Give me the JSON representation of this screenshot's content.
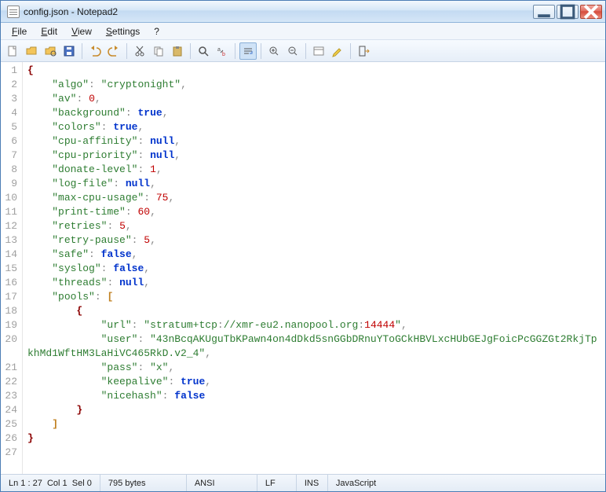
{
  "window": {
    "title": "config.json - Notepad2"
  },
  "menu": {
    "file": "File",
    "edit": "Edit",
    "view": "View",
    "settings": "Settings",
    "help": "?"
  },
  "toolbar_icons": [
    "new",
    "open",
    "browse",
    "save",
    "undo",
    "redo",
    "cut",
    "copy",
    "paste",
    "find",
    "replace",
    "wordwrap",
    "zoomin",
    "zoomout",
    "scheme",
    "highlight",
    "exit"
  ],
  "code": {
    "lines": [
      {
        "n": 1,
        "raw": "{"
      },
      {
        "n": 2,
        "raw": "    \"algo\": \"cryptonight\","
      },
      {
        "n": 3,
        "raw": "    \"av\": 0,"
      },
      {
        "n": 4,
        "raw": "    \"background\": true,"
      },
      {
        "n": 5,
        "raw": "    \"colors\": true,"
      },
      {
        "n": 6,
        "raw": "    \"cpu-affinity\": null,"
      },
      {
        "n": 7,
        "raw": "    \"cpu-priority\": null,"
      },
      {
        "n": 8,
        "raw": "    \"donate-level\": 1,"
      },
      {
        "n": 9,
        "raw": "    \"log-file\": null,"
      },
      {
        "n": 10,
        "raw": "    \"max-cpu-usage\": 75,"
      },
      {
        "n": 11,
        "raw": "    \"print-time\": 60,"
      },
      {
        "n": 12,
        "raw": "    \"retries\": 5,"
      },
      {
        "n": 13,
        "raw": "    \"retry-pause\": 5,"
      },
      {
        "n": 14,
        "raw": "    \"safe\": false,"
      },
      {
        "n": 15,
        "raw": "    \"syslog\": false,"
      },
      {
        "n": 16,
        "raw": "    \"threads\": null,"
      },
      {
        "n": 17,
        "raw": "    \"pools\": ["
      },
      {
        "n": 18,
        "raw": "        {"
      },
      {
        "n": 19,
        "raw": "            \"url\": \"stratum+tcp://xmr-eu2.nanopool.org:14444\","
      },
      {
        "n": 20,
        "raw": "            \"user\": \"43nBcqAKUguTbKPawn4on4dDkd5snGGbDRnuYToGCkHBVLxcHUbGEJgFoicPcGGZGt2RkjTpkhMd1WftHM3LaHiVC465RkD.v2_4\","
      },
      {
        "n": 21,
        "raw": "            \"pass\": \"x\","
      },
      {
        "n": 22,
        "raw": "            \"keepalive\": true,"
      },
      {
        "n": 23,
        "raw": "            \"nicehash\": false"
      },
      {
        "n": 24,
        "raw": "        }"
      },
      {
        "n": 25,
        "raw": "    ]"
      },
      {
        "n": 26,
        "raw": "}"
      },
      {
        "n": 27,
        "raw": ""
      }
    ]
  },
  "status": {
    "pos": "Ln 1 : 27",
    "col": "Col 1",
    "sel": "Sel 0",
    "bytes": "795 bytes",
    "enc": "ANSI",
    "eol": "LF",
    "ins": "INS",
    "lang": "JavaScript"
  }
}
